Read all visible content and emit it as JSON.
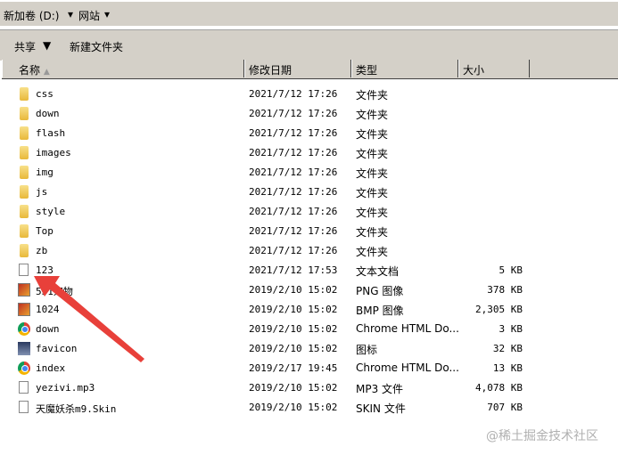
{
  "address": {
    "drive": "新加卷 (D:)",
    "folder": "网站"
  },
  "toolbar": {
    "share": "共享",
    "new_folder": "新建文件夹"
  },
  "columns": {
    "name": "名称",
    "date": "修改日期",
    "type": "类型",
    "size": "大小"
  },
  "files": [
    {
      "name": "css",
      "date": "2021/7/12 17:26",
      "type": "文件夹",
      "size": "",
      "icon": "folder"
    },
    {
      "name": "down",
      "date": "2021/7/12 17:26",
      "type": "文件夹",
      "size": "",
      "icon": "folder"
    },
    {
      "name": "flash",
      "date": "2021/7/12 17:26",
      "type": "文件夹",
      "size": "",
      "icon": "folder"
    },
    {
      "name": "images",
      "date": "2021/7/12 17:26",
      "type": "文件夹",
      "size": "",
      "icon": "folder"
    },
    {
      "name": "img",
      "date": "2021/7/12 17:26",
      "type": "文件夹",
      "size": "",
      "icon": "folder"
    },
    {
      "name": "js",
      "date": "2021/7/12 17:26",
      "type": "文件夹",
      "size": "",
      "icon": "folder"
    },
    {
      "name": "style",
      "date": "2021/7/12 17:26",
      "type": "文件夹",
      "size": "",
      "icon": "folder"
    },
    {
      "name": "Top",
      "date": "2021/7/12 17:26",
      "type": "文件夹",
      "size": "",
      "icon": "folder"
    },
    {
      "name": "zb",
      "date": "2021/7/12 17:26",
      "type": "文件夹",
      "size": "",
      "icon": "folder"
    },
    {
      "name": "123",
      "date": "2021/7/12 17:53",
      "type": "文本文档",
      "size": "5 KB",
      "icon": "doc"
    },
    {
      "name": "531宠物",
      "date": "2019/2/10 15:02",
      "type": "PNG 图像",
      "size": "378 KB",
      "icon": "img"
    },
    {
      "name": "1024",
      "date": "2019/2/10 15:02",
      "type": "BMP 图像",
      "size": "2,305 KB",
      "icon": "img"
    },
    {
      "name": "down",
      "date": "2019/2/10 15:02",
      "type": "Chrome HTML Do...",
      "size": "3 KB",
      "icon": "chrome"
    },
    {
      "name": "favicon",
      "date": "2019/2/10 15:02",
      "type": "图标",
      "size": "32 KB",
      "icon": "avatar"
    },
    {
      "name": "index",
      "date": "2019/2/17 19:45",
      "type": "Chrome HTML Do...",
      "size": "13 KB",
      "icon": "chrome"
    },
    {
      "name": "yezivi.mp3",
      "date": "2019/2/10 15:02",
      "type": "MP3 文件",
      "size": "4,078 KB",
      "icon": "doc"
    },
    {
      "name": "天魔妖杀m9.Skin",
      "date": "2019/2/10 15:02",
      "type": "SKIN 文件",
      "size": "707 KB",
      "icon": "doc"
    }
  ],
  "watermark": "@稀土掘金技术社区",
  "colors": {
    "chrome": "#d4d0c8",
    "arrow": "#e8403a"
  }
}
